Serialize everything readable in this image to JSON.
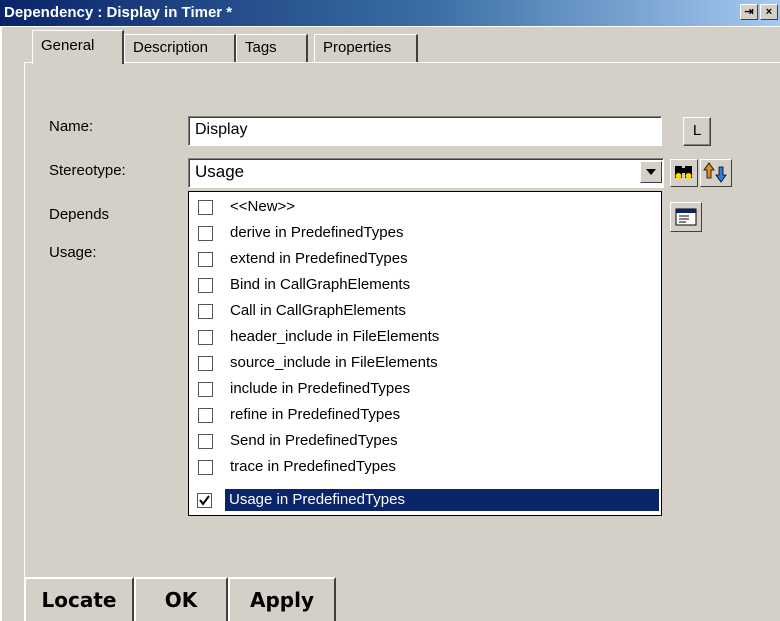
{
  "window": {
    "title": "Dependency : Display in Timer *",
    "controls": [
      "pin-icon",
      "close-icon"
    ]
  },
  "tabs": [
    {
      "label": "General",
      "active": true
    },
    {
      "label": "Description",
      "active": false
    },
    {
      "label": "Tags",
      "active": false
    },
    {
      "label": "Properties",
      "active": false
    }
  ],
  "form": {
    "name_label": "Name:",
    "name_value": "Display",
    "l_button": "L",
    "stereotype_label": "Stereotype:",
    "stereotype_value": "Usage",
    "depends_label": "Depends",
    "usage_label": "Usage:"
  },
  "stereotype_options": [
    {
      "label": "<<New>>",
      "checked": false
    },
    {
      "label": "derive in PredefinedTypes",
      "checked": false
    },
    {
      "label": "extend in PredefinedTypes",
      "checked": false
    },
    {
      "label": "Bind in CallGraphElements",
      "checked": false
    },
    {
      "label": "Call in CallGraphElements",
      "checked": false
    },
    {
      "label": "header_include in FileElements",
      "checked": false
    },
    {
      "label": "source_include in FileElements",
      "checked": false
    },
    {
      "label": "include in PredefinedTypes",
      "checked": false
    },
    {
      "label": "refine in PredefinedTypes",
      "checked": false
    },
    {
      "label": "Send in PredefinedTypes",
      "checked": false
    },
    {
      "label": "trace in PredefinedTypes",
      "checked": false
    },
    {
      "label": "Usage in PredefinedTypes",
      "checked": true,
      "selected": true
    }
  ],
  "side_icons": [
    "binoculars-icon",
    "arrows-icon",
    "properties-icon"
  ],
  "footer": {
    "locate": "Locate",
    "ok": "OK",
    "apply": "Apply"
  },
  "colors": {
    "title_start": "#0a246a",
    "title_end": "#a6caf0",
    "selection": "#0a246a",
    "face": "#d4d0c8"
  }
}
